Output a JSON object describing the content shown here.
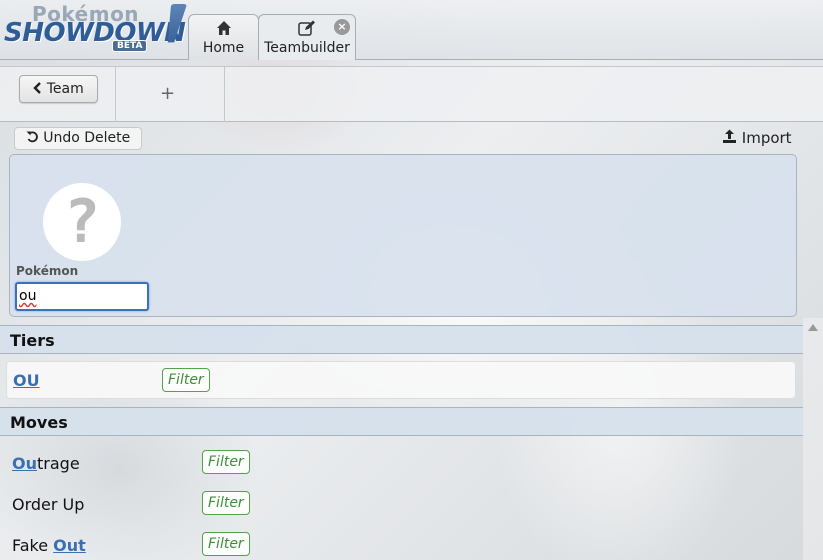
{
  "logo": {
    "line1": "Pokémon",
    "line2": "SHOWDOWN",
    "badge": "BETA"
  },
  "tabs": [
    {
      "label": "Home",
      "icon": "home-icon"
    },
    {
      "label": "Teambuilder",
      "icon": "edit-icon",
      "close_icon": "close-icon"
    }
  ],
  "subnav": {
    "back_label": "Team",
    "add_label": "+"
  },
  "toolbar": {
    "undo_label": "Undo Delete",
    "import_label": "Import"
  },
  "set_editor": {
    "sprite_placeholder": "?",
    "pokemon_label": "Pokémon",
    "pokemon_value": "ou"
  },
  "results": {
    "tiers_header": "Tiers",
    "tiers": [
      {
        "name": "OU",
        "filter": "Filter"
      }
    ],
    "moves_header": "Moves",
    "moves": [
      {
        "before": "",
        "match": "Ou",
        "after": "trage",
        "filter": "Filter"
      },
      {
        "before": "Order Up",
        "match": "",
        "after": "",
        "filter": "Filter"
      },
      {
        "before": "Fake ",
        "match": "Out",
        "after": "",
        "filter": "Filter"
      }
    ]
  }
}
